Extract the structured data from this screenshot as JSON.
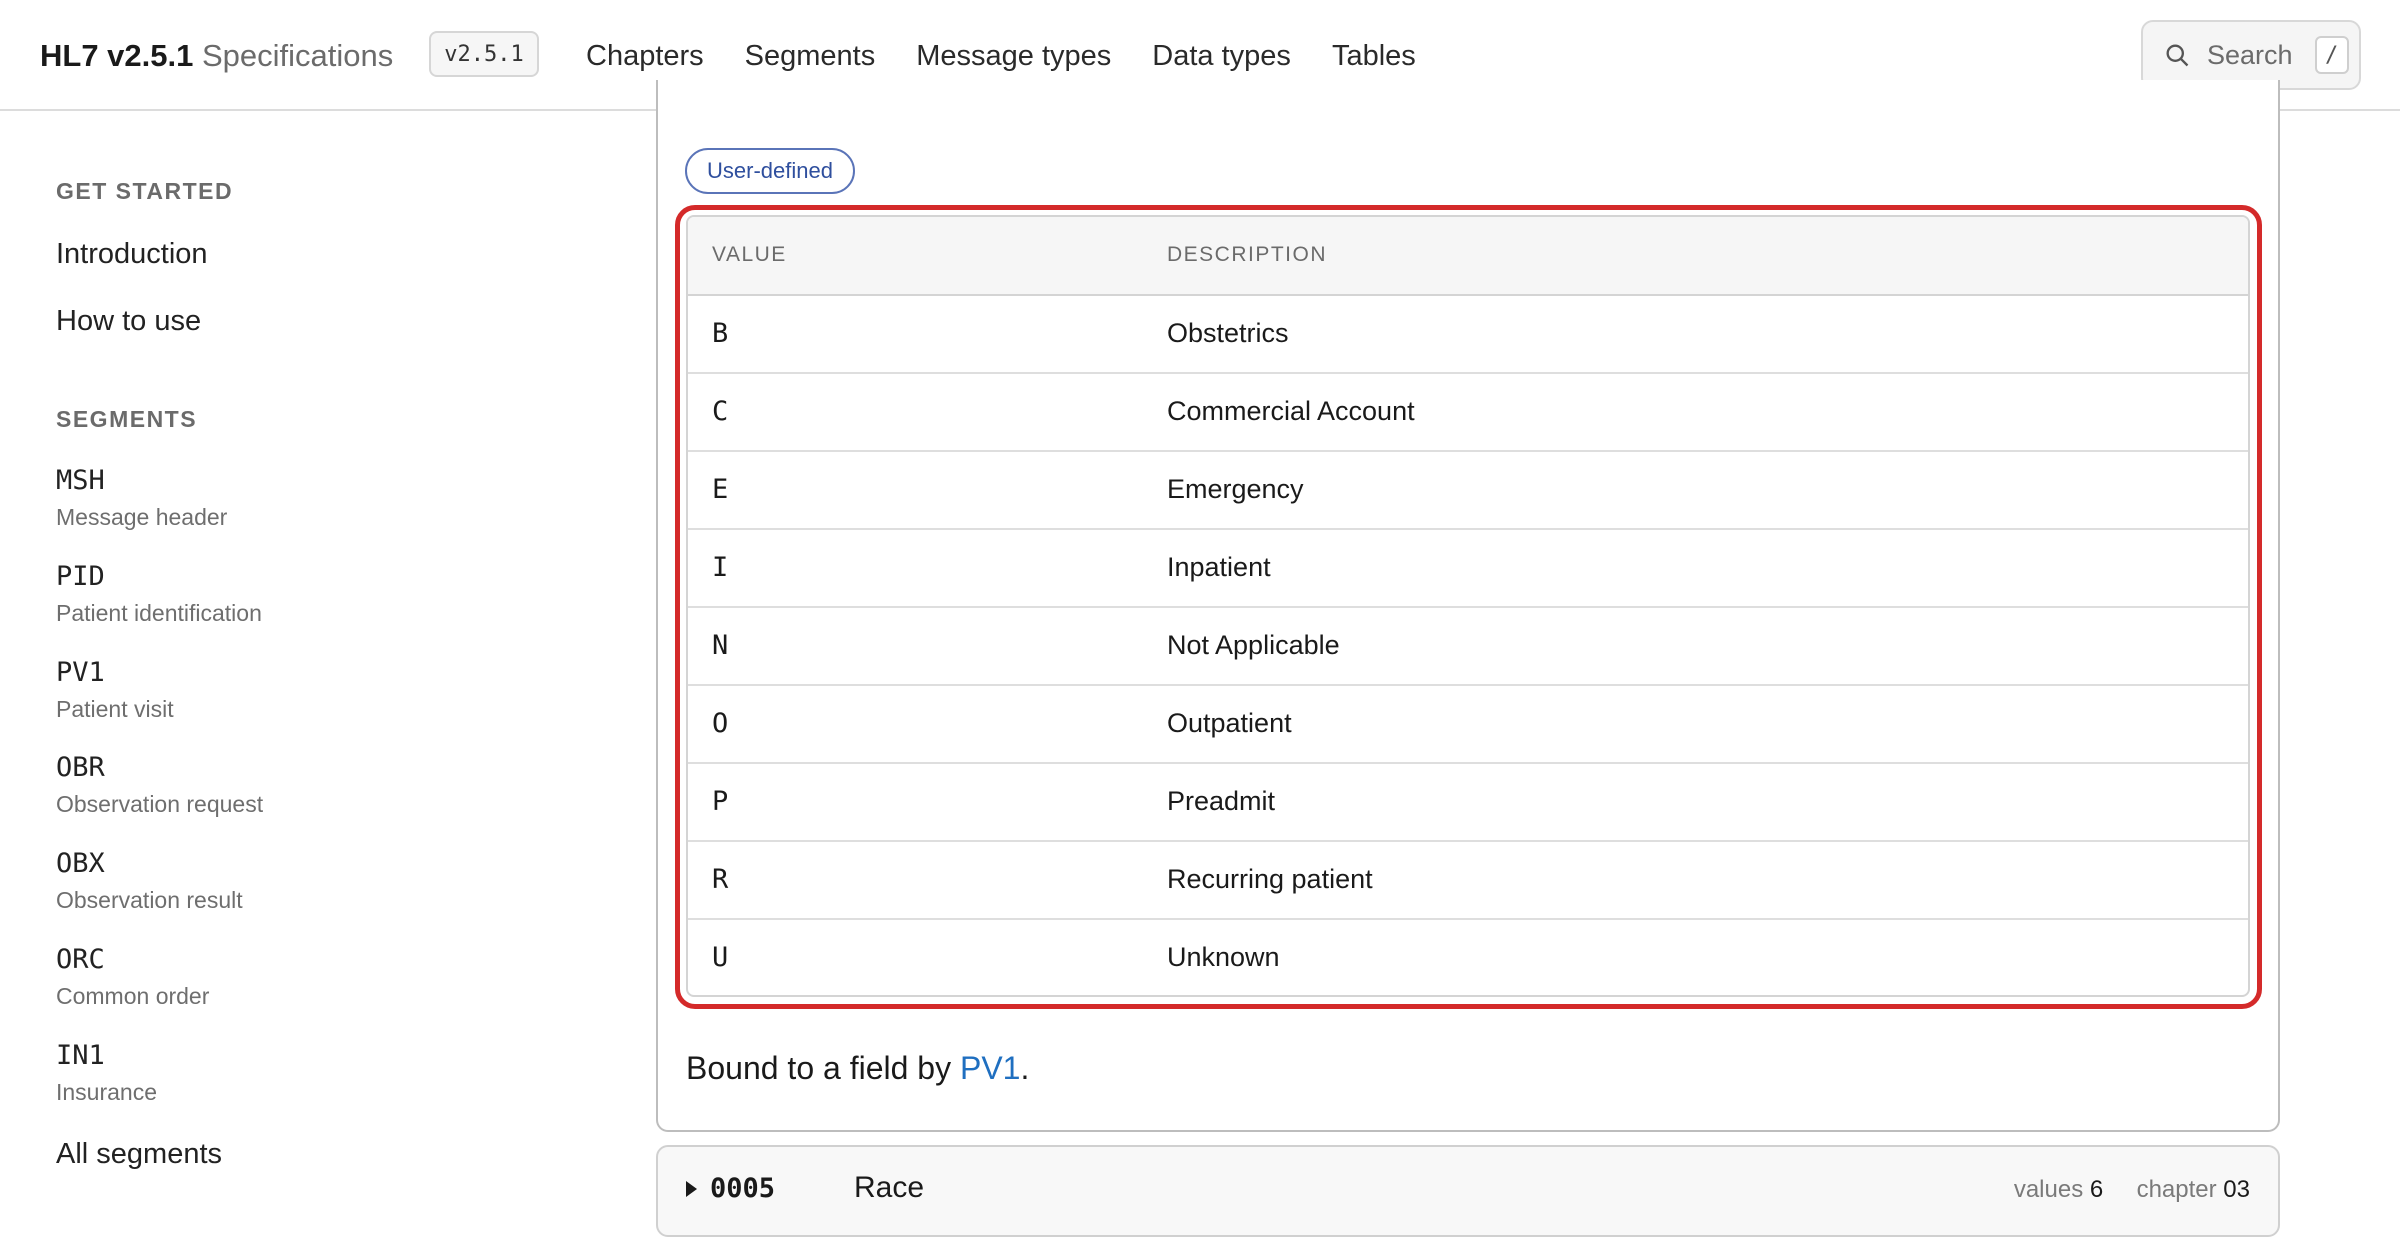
{
  "header": {
    "brand_name": "HL7 v2.5.1",
    "brand_sub": "Specifications",
    "version": "v2.5.1",
    "nav": [
      "Chapters",
      "Segments",
      "Message types",
      "Data types",
      "Tables"
    ],
    "search_label": "Search",
    "search_shortcut": "/"
  },
  "sidebar": {
    "get_started_title": "GET STARTED",
    "get_started": [
      "Introduction",
      "How to use"
    ],
    "segments_title": "SEGMENTS",
    "segments": [
      {
        "code": "MSH",
        "desc": "Message header"
      },
      {
        "code": "PID",
        "desc": "Patient identification"
      },
      {
        "code": "PV1",
        "desc": "Patient visit"
      },
      {
        "code": "OBR",
        "desc": "Observation request"
      },
      {
        "code": "OBX",
        "desc": "Observation result"
      },
      {
        "code": "ORC",
        "desc": "Common order"
      },
      {
        "code": "IN1",
        "desc": "Insurance"
      }
    ],
    "all_segments": "All segments"
  },
  "table_card": {
    "chip": "User-defined",
    "columns": [
      "VALUE",
      "DESCRIPTION"
    ],
    "rows": [
      {
        "value": "B",
        "desc": "Obstetrics"
      },
      {
        "value": "C",
        "desc": "Commercial Account"
      },
      {
        "value": "E",
        "desc": "Emergency"
      },
      {
        "value": "I",
        "desc": "Inpatient"
      },
      {
        "value": "N",
        "desc": "Not Applicable"
      },
      {
        "value": "O",
        "desc": "Outpatient"
      },
      {
        "value": "P",
        "desc": "Preadmit"
      },
      {
        "value": "R",
        "desc": "Recurring patient"
      },
      {
        "value": "U",
        "desc": "Unknown"
      }
    ],
    "bound_prefix": "Bound to a field by ",
    "bound_link": "PV1",
    "bound_suffix": "."
  },
  "next_card": {
    "code": "0005",
    "title": "Race",
    "values_label": "values",
    "values_count": "6",
    "chapter_label": "chapter",
    "chapter_num": "03"
  },
  "colors": {
    "highlight": "#d42a2a",
    "link": "#1f6fc0",
    "chip_border": "#5a74b8"
  }
}
